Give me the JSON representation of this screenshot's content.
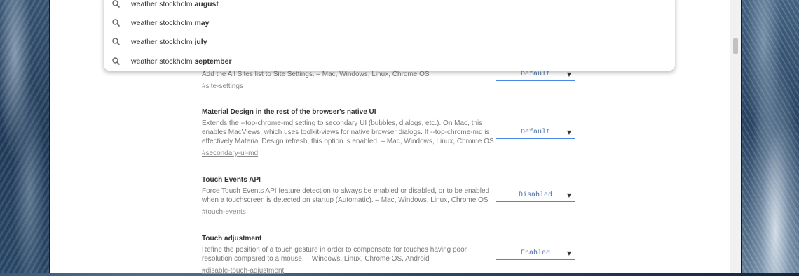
{
  "omnibox_suggestions": [
    {
      "base": "weather stockholm",
      "completion": "august",
      "icon": "search-icon"
    },
    {
      "base": "weather stockholm",
      "completion": "may",
      "icon": "search-icon"
    },
    {
      "base": "weather stockholm",
      "completion": "july",
      "icon": "search-icon"
    },
    {
      "base": "weather stockholm",
      "completion": "september",
      "icon": "search-icon"
    }
  ],
  "flags": [
    {
      "title": "",
      "description": "Add the All Sites list to Site Settings. – Mac, Windows, Linux, Chrome OS",
      "link": "#site-settings",
      "select_value": "Default"
    },
    {
      "title": "Material Design in the rest of the browser's native UI",
      "description": "Extends the --top-chrome-md setting to secondary UI (bubbles, dialogs, etc.). On Mac, this enables MacViews, which uses toolkit-views for native browser dialogs. If --top-chrome-md is effectively Material Design refresh, this option is enabled. – Mac, Windows, Linux, Chrome OS",
      "link": "#secondary-ui-md",
      "select_value": "Default"
    },
    {
      "title": "Touch Events API",
      "description": "Force Touch Events API feature detection to always be enabled or disabled, or to be enabled when a touchscreen is detected on startup (Automatic). – Mac, Windows, Linux, Chrome OS",
      "link": "#touch-events",
      "select_value": "Disabled"
    },
    {
      "title": "Touch adjustment",
      "description": "Refine the position of a touch gesture in order to compensate for touches having poor resolution compared to a mouse. – Windows, Linux, Chrome OS, Android",
      "link": "#disable-touch-adjustment",
      "select_value": "Enabled"
    }
  ],
  "colors": {
    "select_border": "#4a86e8",
    "select_text": "#4a6fa8"
  }
}
